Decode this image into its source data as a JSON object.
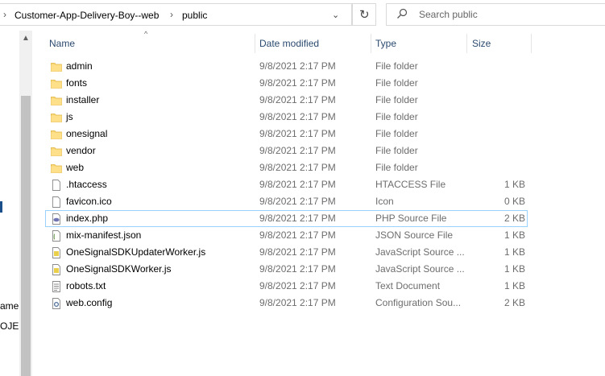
{
  "address": {
    "segments": [
      "Customer-App-Delivery-Boy--web",
      "public"
    ]
  },
  "search": {
    "placeholder": "Search public"
  },
  "nav": {
    "fragments": [
      "ame",
      "OJEC"
    ]
  },
  "columns": {
    "name": "Name",
    "date": "Date modified",
    "type": "Type",
    "size": "Size"
  },
  "files": [
    {
      "name": "admin",
      "date": "9/8/2021 2:17 PM",
      "type": "File folder",
      "size": "",
      "icon": "folder-icon"
    },
    {
      "name": "fonts",
      "date": "9/8/2021 2:17 PM",
      "type": "File folder",
      "size": "",
      "icon": "folder-icon"
    },
    {
      "name": "installer",
      "date": "9/8/2021 2:17 PM",
      "type": "File folder",
      "size": "",
      "icon": "folder-icon"
    },
    {
      "name": "js",
      "date": "9/8/2021 2:17 PM",
      "type": "File folder",
      "size": "",
      "icon": "folder-icon"
    },
    {
      "name": "onesignal",
      "date": "9/8/2021 2:17 PM",
      "type": "File folder",
      "size": "",
      "icon": "folder-icon"
    },
    {
      "name": "vendor",
      "date": "9/8/2021 2:17 PM",
      "type": "File folder",
      "size": "",
      "icon": "folder-icon"
    },
    {
      "name": "web",
      "date": "9/8/2021 2:17 PM",
      "type": "File folder",
      "size": "",
      "icon": "folder-icon"
    },
    {
      "name": ".htaccess",
      "date": "9/8/2021 2:17 PM",
      "type": "HTACCESS File",
      "size": "1 KB",
      "icon": "file-icon"
    },
    {
      "name": "favicon.ico",
      "date": "9/8/2021 2:17 PM",
      "type": "Icon",
      "size": "0 KB",
      "icon": "file-icon"
    },
    {
      "name": "index.php",
      "date": "9/8/2021 2:17 PM",
      "type": "PHP Source File",
      "size": "2 KB",
      "icon": "php-file-icon",
      "selected": true
    },
    {
      "name": "mix-manifest.json",
      "date": "9/8/2021 2:17 PM",
      "type": "JSON Source File",
      "size": "1 KB",
      "icon": "json-file-icon"
    },
    {
      "name": "OneSignalSDKUpdaterWorker.js",
      "date": "9/8/2021 2:17 PM",
      "type": "JavaScript Source ...",
      "size": "1 KB",
      "icon": "js-file-icon"
    },
    {
      "name": "OneSignalSDKWorker.js",
      "date": "9/8/2021 2:17 PM",
      "type": "JavaScript Source ...",
      "size": "1 KB",
      "icon": "js-file-icon"
    },
    {
      "name": "robots.txt",
      "date": "9/8/2021 2:17 PM",
      "type": "Text Document",
      "size": "1 KB",
      "icon": "text-file-icon"
    },
    {
      "name": "web.config",
      "date": "9/8/2021 2:17 PM",
      "type": "Configuration Sou...",
      "size": "2 KB",
      "icon": "config-file-icon"
    }
  ]
}
